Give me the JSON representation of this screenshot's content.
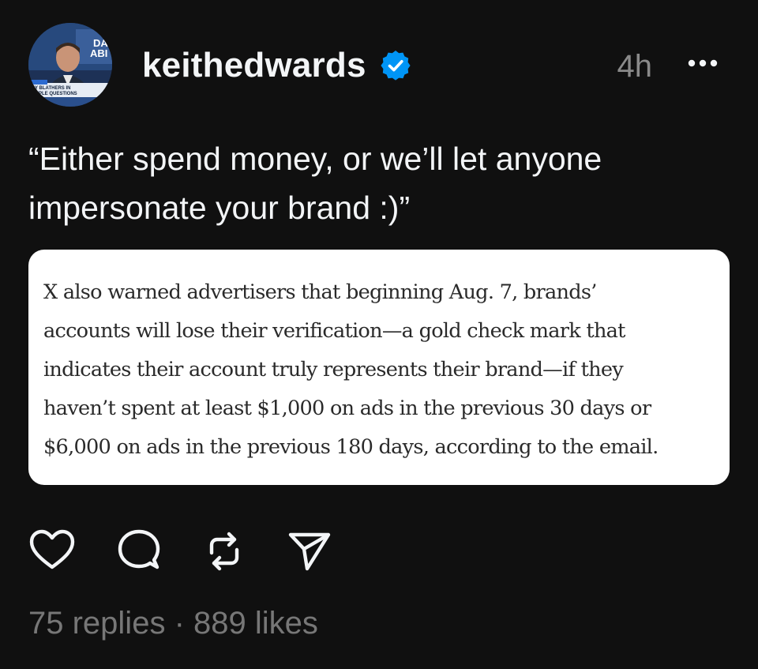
{
  "post": {
    "username": "keithedwards",
    "timestamp": "4h",
    "caption": "“Either spend money, or we’ll let anyone impersonate your brand :)”",
    "quoted_text_lines": [
      "X also warned advertisers that beginning Aug. 7, brands’",
      "accounts will lose their verification—a gold check mark that",
      "indicates their account truly represents their brand—if they",
      "haven’t spent at least $1,000 on ads in the previous 30 days or",
      "$6,000 on ads in the previous 180 days, according to the email."
    ],
    "replies": "75 replies",
    "separator": "·",
    "likes": "889 likes"
  },
  "avatar": {
    "overlay_text_1": "DA",
    "overlay_text_2": "ABI",
    "lower_third_1": "Y BLATHERS IN",
    "lower_third_2": "MPLE QUESTIONS"
  },
  "icons": {
    "verified": "verified-badge-icon",
    "more": "more-options-icon",
    "like": "heart-icon",
    "reply": "comment-bubble-icon",
    "repost": "repost-icon",
    "share": "send-icon"
  },
  "colors": {
    "background": "#101010",
    "text_primary": "#f3f5f7",
    "text_secondary": "#8a8a8a",
    "verified_blue": "#0095f6",
    "card_background": "#ffffff"
  }
}
